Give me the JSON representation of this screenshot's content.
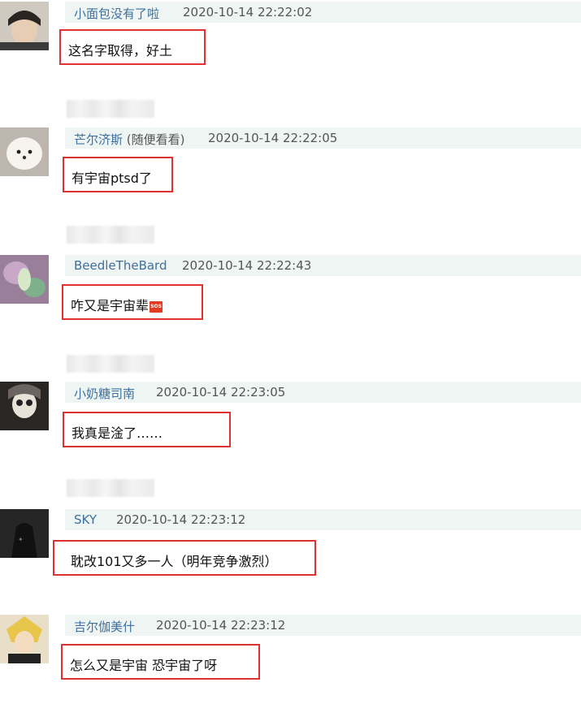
{
  "comments": [
    {
      "username": "小面包没有了啦",
      "note": "",
      "timestamp": "2020-10-14 22:22:02",
      "text": "这名字取得，好土"
    },
    {
      "username": "芒尔济斯",
      "note": "(随便看看)",
      "timestamp": "2020-10-14 22:22:05",
      "text": "有宇宙ptsd了"
    },
    {
      "username": "BeedleTheBard",
      "note": "",
      "timestamp": "2020-10-14 22:22:43",
      "text": "咋又是宇宙辈"
    },
    {
      "username": "小奶糖司南",
      "note": "",
      "timestamp": "2020-10-14 22:23:05",
      "text": "我真是淦了……"
    },
    {
      "username": "SKY",
      "note": "",
      "timestamp": "2020-10-14 22:23:12",
      "text": "耽改101又多一人（明年竞争激烈）"
    },
    {
      "username": "吉尔伽美什",
      "note": "",
      "timestamp": "2020-10-14 22:23:12",
      "text": "怎么又是宇宙 恐宇宙了呀"
    }
  ],
  "emoji": {
    "sos_label": "SOS",
    "sos_color": "#e23a1e"
  },
  "colors": {
    "highlight_border": "#e03030",
    "meta_bar": "#eef5f2",
    "username": "#3e6fa0"
  },
  "icons": [
    "avatar-image",
    "sos-emoji-icon"
  ]
}
